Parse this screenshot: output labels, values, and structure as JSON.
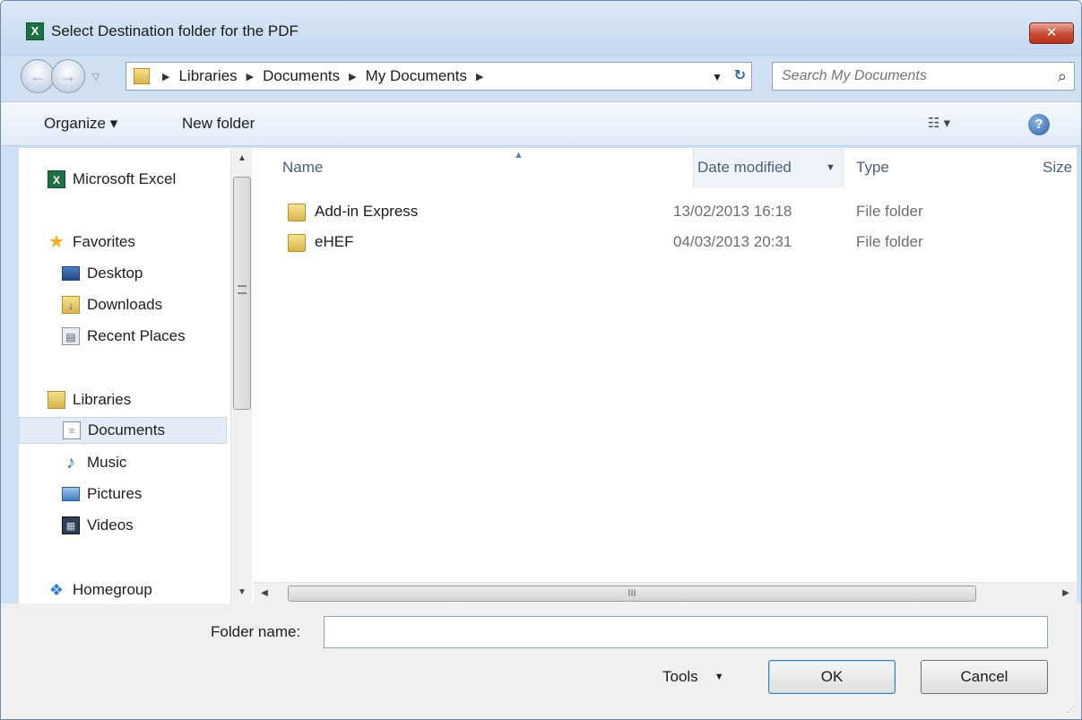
{
  "window": {
    "title": "Select Destination folder for the PDF",
    "title_icon": "X",
    "close_label": "✕"
  },
  "nav": {
    "breadcrumbs": [
      "Libraries",
      "Documents",
      "My Documents"
    ],
    "search_placeholder": "Search My Documents"
  },
  "toolbar": {
    "organize_label": "Organize ▾",
    "new_folder_label": "New folder",
    "view_label": "☷ ▾",
    "help_label": "?"
  },
  "sidebar": {
    "items": [
      {
        "label": "Microsoft Excel",
        "icon": "excel-icon"
      },
      {
        "label": "Favorites",
        "icon": "star-icon"
      },
      {
        "label": "Desktop",
        "icon": "desktop-icon"
      },
      {
        "label": "Downloads",
        "icon": "downloads-icon"
      },
      {
        "label": "Recent Places",
        "icon": "recent-places-icon"
      },
      {
        "label": "Libraries",
        "icon": "libraries-icon"
      },
      {
        "label": "Documents",
        "icon": "document-icon",
        "selected": true
      },
      {
        "label": "Music",
        "icon": "music-icon"
      },
      {
        "label": "Pictures",
        "icon": "pictures-icon"
      },
      {
        "label": "Videos",
        "icon": "videos-icon"
      },
      {
        "label": "Homegroup",
        "icon": "homegroup-icon"
      }
    ]
  },
  "files": {
    "columns": {
      "name": "Name",
      "date": "Date modified",
      "type": "Type",
      "size": "Size"
    },
    "rows": [
      {
        "name": "Add-in Express",
        "date": "13/02/2013 16:18",
        "type": "File folder"
      },
      {
        "name": "eHEF",
        "date": "04/03/2013 20:31",
        "type": "File folder"
      }
    ],
    "hscroll_grip": "III"
  },
  "footer": {
    "folder_name_label": "Folder name:",
    "folder_name_value": "",
    "tools_label": "Tools",
    "ok_label": "OK",
    "cancel_label": "Cancel"
  },
  "colors": {
    "window_frame": "#cfe0f2",
    "close_button": "#c94a35",
    "selection": "#e4edf7",
    "accent": "#3c7fb1"
  }
}
